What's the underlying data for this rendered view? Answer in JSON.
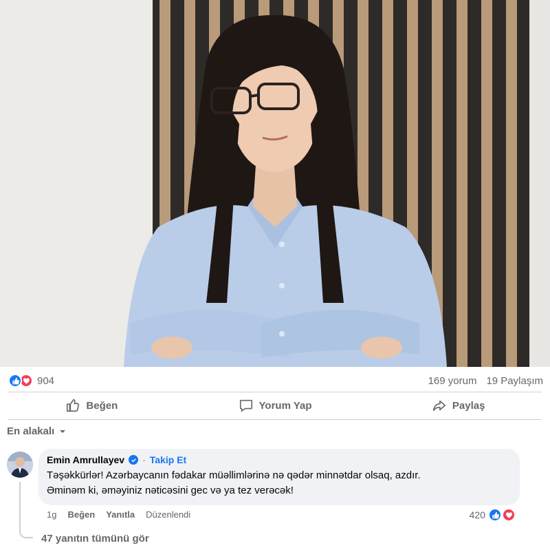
{
  "post": {
    "reactions_count": "904",
    "comments_count": "169 yorum",
    "shares_count": "19 Paylaşım",
    "icons": [
      "like-icon",
      "love-icon"
    ]
  },
  "actions": {
    "like": "Beğen",
    "comment": "Yorum Yap",
    "share": "Paylaş"
  },
  "sort": {
    "label": "En alakalı"
  },
  "comment": {
    "author": "Emin Amrullayev",
    "follow": "Takip Et",
    "text_line1": "Təşəkkürlər! Azərbaycanın fədakar müəllimlərinə nə qədər minnətdar olsaq, azdır.",
    "text_line2": "Əminəm ki, əməyiniz nəticəsini gec və ya tez verəcək!",
    "time": "1g",
    "like": "Beğen",
    "reply": "Yanıtla",
    "edited": "Düzenlendi",
    "reactions_count": "420"
  },
  "replies": {
    "label": "47 yanıtın tümünü gör"
  },
  "colors": {
    "accent": "#1877f2",
    "love": "#f33e58",
    "muted": "#65676b",
    "bubble": "#f0f2f5"
  }
}
